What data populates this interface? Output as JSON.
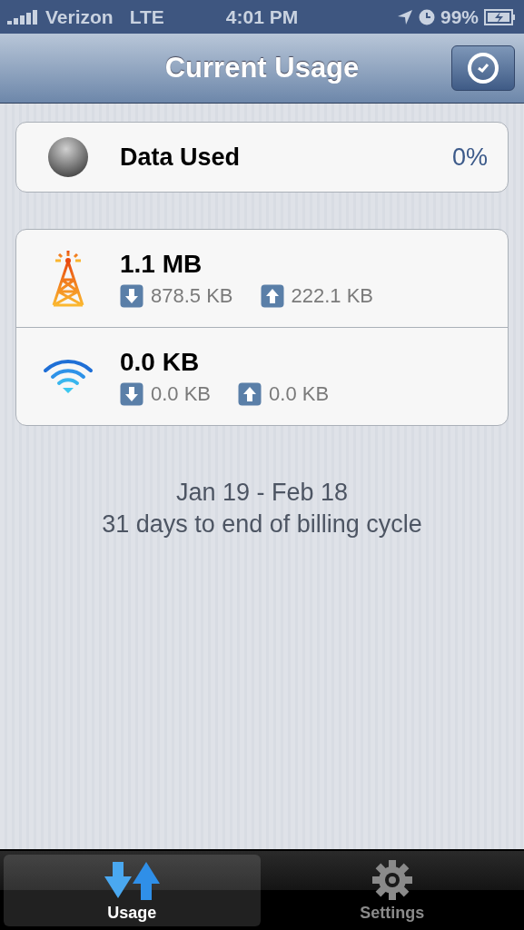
{
  "status_bar": {
    "carrier": "Verizon",
    "network": "LTE",
    "time": "4:01 PM",
    "battery": "99%"
  },
  "nav_bar": {
    "title": "Current Usage"
  },
  "summary": {
    "label": "Data Used",
    "value": "0%"
  },
  "usage_rows": [
    {
      "kind": "cellular",
      "total": "1.1 MB",
      "download": "878.5 KB",
      "upload": "222.1 KB"
    },
    {
      "kind": "wifi",
      "total": "0.0 KB",
      "download": "0.0 KB",
      "upload": "0.0 KB"
    }
  ],
  "billing": {
    "period": "Jan 19 - Feb 18",
    "remaining": "31 days to end of billing cycle"
  },
  "tabs": [
    {
      "kind": "usage",
      "label": "Usage",
      "selected": true
    },
    {
      "kind": "settings",
      "label": "Settings",
      "selected": false
    }
  ]
}
